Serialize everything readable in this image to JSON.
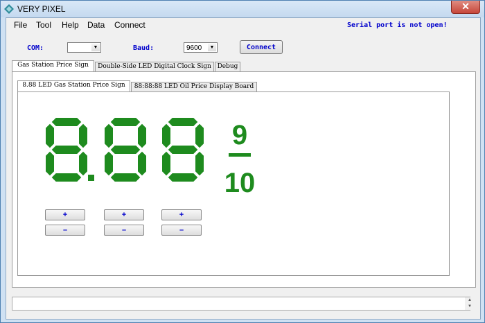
{
  "window": {
    "title": "VERY PIXEL",
    "close_glyph": "✕"
  },
  "menu": [
    "File",
    "Tool",
    "Help",
    "Data",
    "Connect"
  ],
  "status": {
    "serial": "Serial port is not open!"
  },
  "connection": {
    "com_label": "COM:",
    "com_value": "",
    "baud_label": "Baud:",
    "baud_value": "9600",
    "connect_label": "Connect"
  },
  "tabs": [
    "Gas Station Price Sign",
    "Double-Side LED Digital Clock Sign",
    "Debug"
  ],
  "subtabs": [
    "8.88 LED Gas Station Price Sign",
    "88:88:88 LED Oil Price Display Board"
  ],
  "display": {
    "digits": [
      "8",
      "8",
      "8"
    ],
    "fraction_numerator": "9",
    "fraction_denominator": "10",
    "segment_color": "#1e8b1e"
  },
  "stepper": {
    "plus": "+",
    "minus": "–"
  },
  "icons": {
    "app": "diamond-logo-icon",
    "scroll_up": "▲",
    "scroll_down": "▼"
  }
}
